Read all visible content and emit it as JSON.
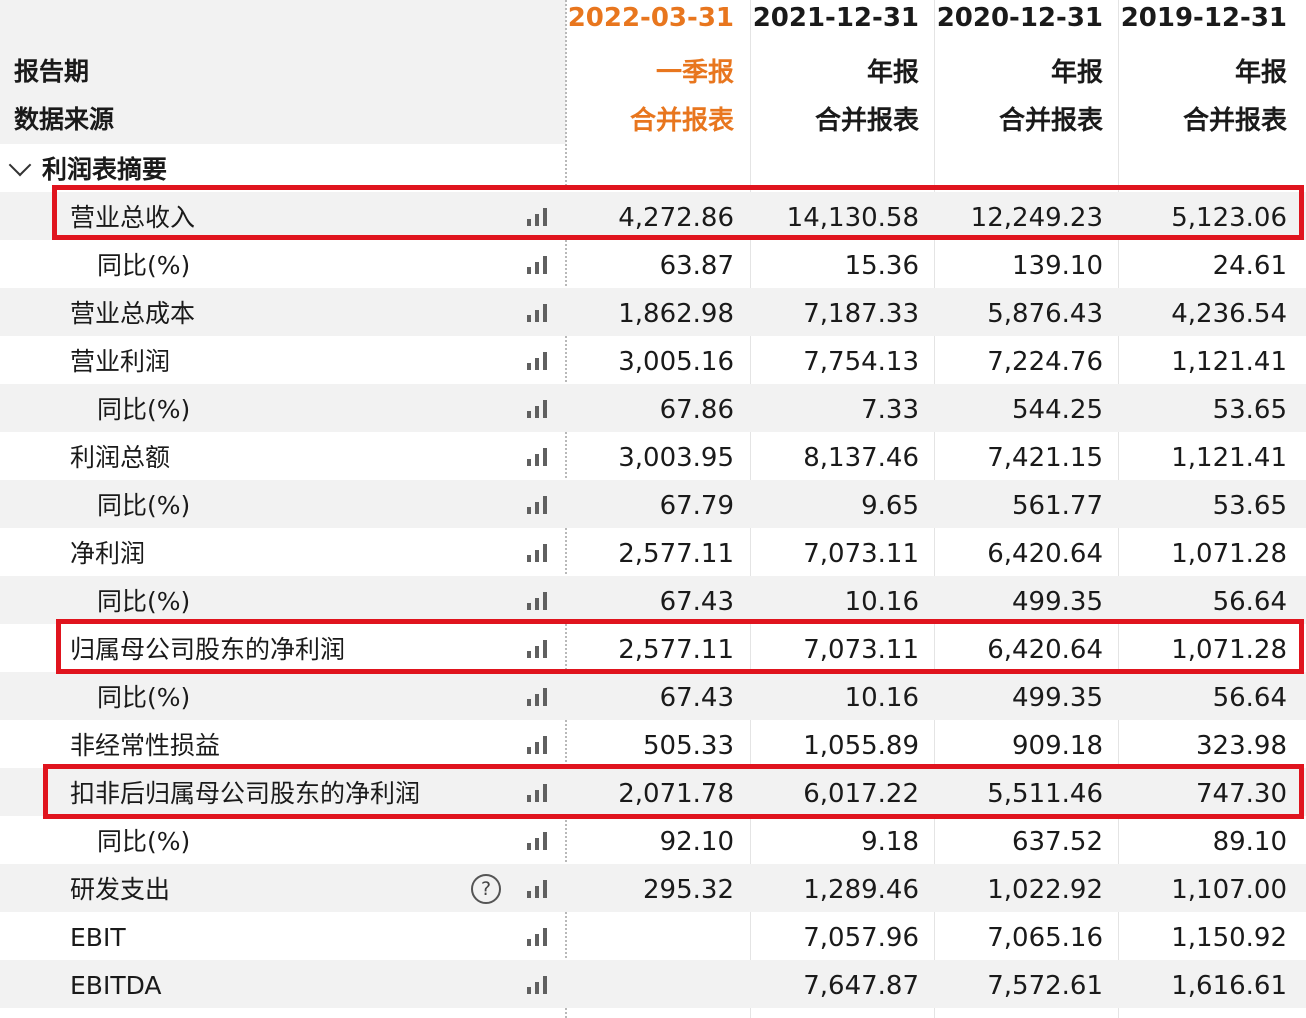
{
  "header": {
    "dates": [
      "2022-03-31",
      "2021-12-31",
      "2020-12-31",
      "2019-12-31"
    ],
    "report_period_label": "报告期",
    "report_types": [
      "一季报",
      "年报",
      "年报",
      "年报"
    ],
    "data_source_label": "数据来源",
    "sources": [
      "合并报表",
      "合并报表",
      "合并报表",
      "合并报表"
    ]
  },
  "section": {
    "title": "利润表摘要"
  },
  "rows": [
    {
      "label": "营业总收入",
      "values": [
        "4,272.86",
        "14,130.58",
        "12,249.23",
        "5,123.06"
      ]
    },
    {
      "label": "同比(%)",
      "values": [
        "63.87",
        "15.36",
        "139.10",
        "24.61"
      ]
    },
    {
      "label": "营业总成本",
      "values": [
        "1,862.98",
        "7,187.33",
        "5,876.43",
        "4,236.54"
      ]
    },
    {
      "label": "营业利润",
      "values": [
        "3,005.16",
        "7,754.13",
        "7,224.76",
        "1,121.41"
      ]
    },
    {
      "label": "同比(%)",
      "values": [
        "67.86",
        "7.33",
        "544.25",
        "53.65"
      ]
    },
    {
      "label": "利润总额",
      "values": [
        "3,003.95",
        "8,137.46",
        "7,421.15",
        "1,121.41"
      ]
    },
    {
      "label": "同比(%)",
      "values": [
        "67.79",
        "9.65",
        "561.77",
        "53.65"
      ]
    },
    {
      "label": "净利润",
      "values": [
        "2,577.11",
        "7,073.11",
        "6,420.64",
        "1,071.28"
      ]
    },
    {
      "label": "同比(%)",
      "values": [
        "67.43",
        "10.16",
        "499.35",
        "56.64"
      ]
    },
    {
      "label": "归属母公司股东的净利润",
      "values": [
        "2,577.11",
        "7,073.11",
        "6,420.64",
        "1,071.28"
      ]
    },
    {
      "label": "同比(%)",
      "values": [
        "67.43",
        "10.16",
        "499.35",
        "56.64"
      ]
    },
    {
      "label": "非经常性损益",
      "values": [
        "505.33",
        "1,055.89",
        "909.18",
        "323.98"
      ]
    },
    {
      "label": "扣非后归属母公司股东的净利润",
      "values": [
        "2,071.78",
        "6,017.22",
        "5,511.46",
        "747.30"
      ]
    },
    {
      "label": "同比(%)",
      "values": [
        "92.10",
        "9.18",
        "637.52",
        "89.10"
      ]
    },
    {
      "label": "研发支出",
      "values": [
        "295.32",
        "1,289.46",
        "1,022.92",
        "1,107.00"
      ]
    },
    {
      "label": "EBIT",
      "values": [
        "",
        "7,057.96",
        "7,065.16",
        "1,150.92"
      ]
    },
    {
      "label": "EBITDA",
      "values": [
        "",
        "7,647.87",
        "7,572.61",
        "1,616.61"
      ]
    }
  ],
  "help_icon_symbol": "?",
  "colors": {
    "current_period": "#e8761e",
    "highlight_border": "#e0141e",
    "row_shade": "#f2f2f2"
  }
}
